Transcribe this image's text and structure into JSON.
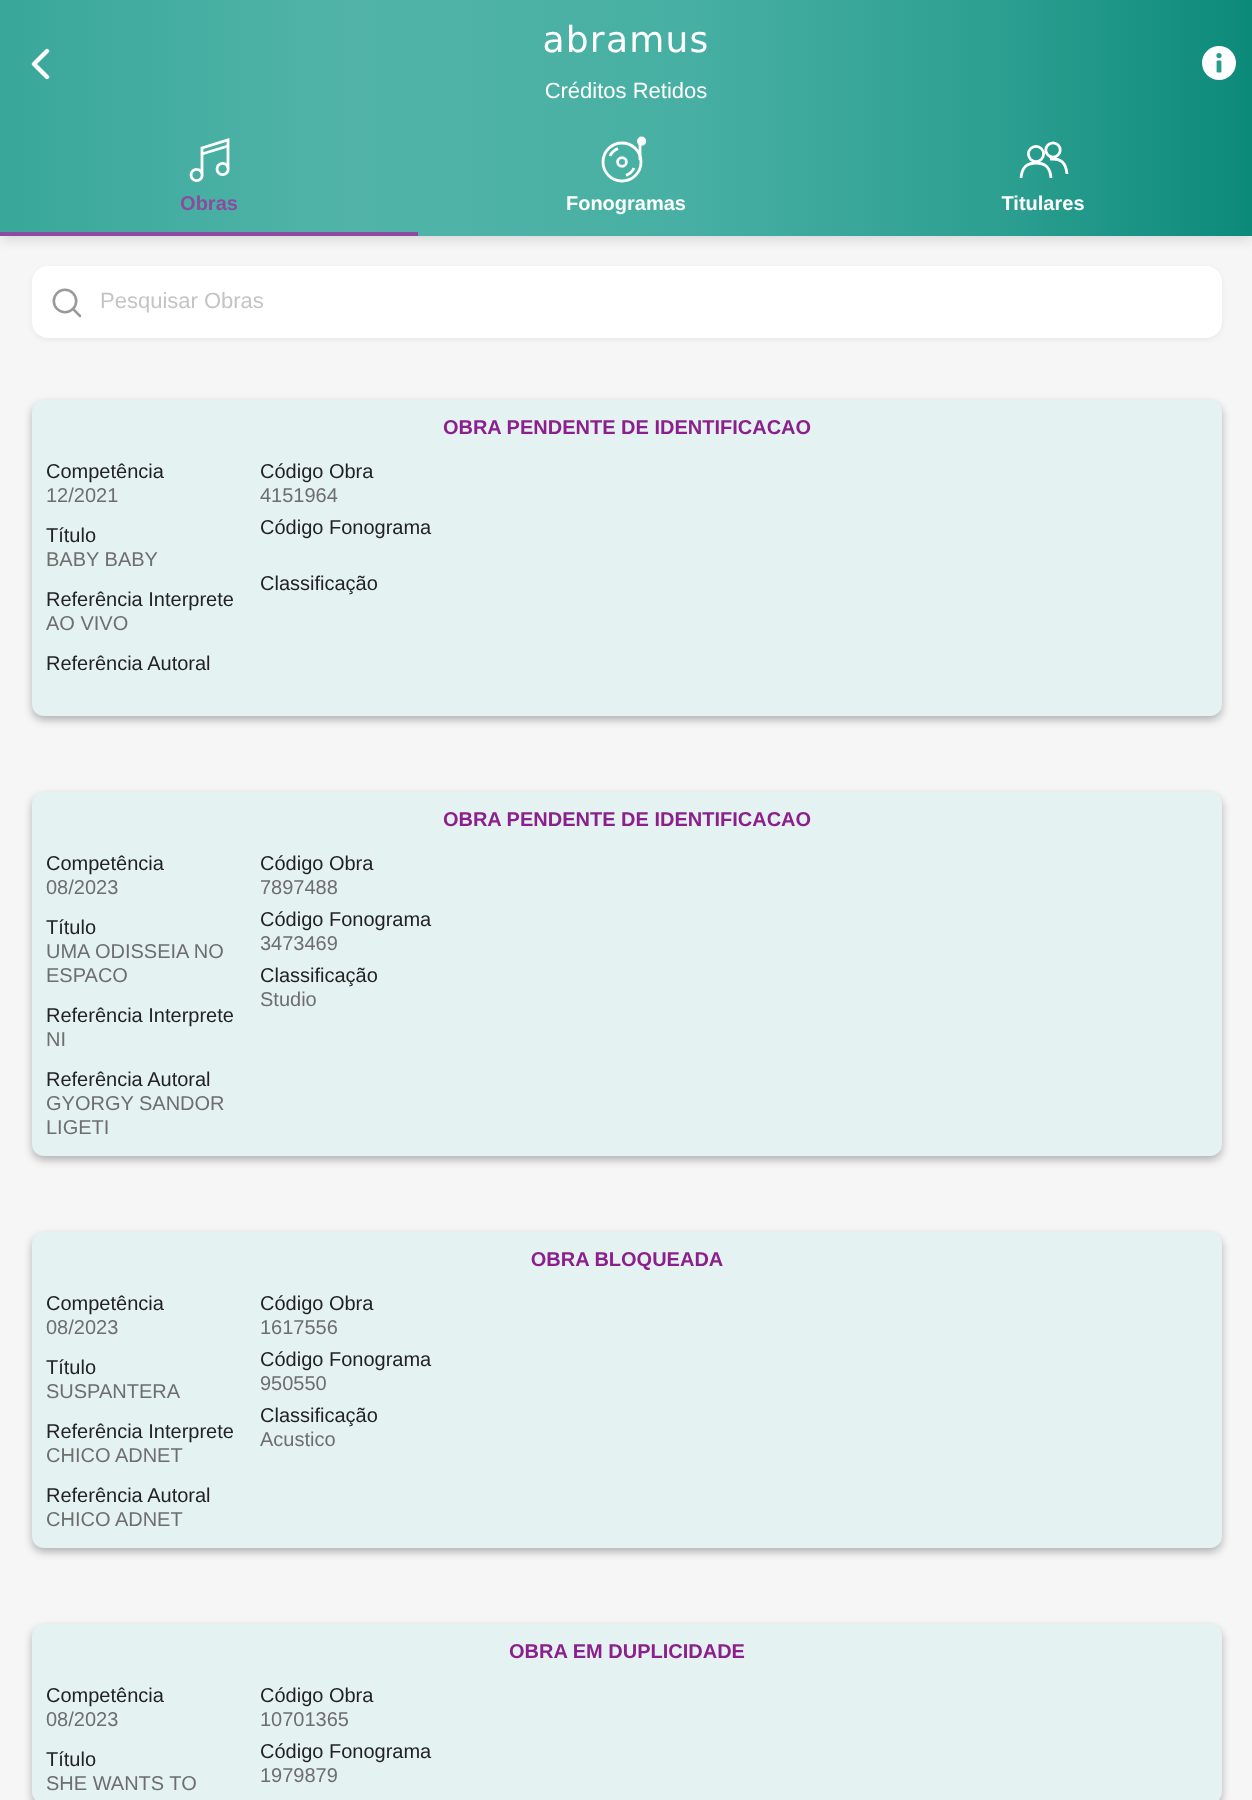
{
  "header": {
    "logo": "abramus",
    "title": "Créditos Retidos"
  },
  "tabs": [
    {
      "label": "Obras",
      "selected": true
    },
    {
      "label": "Fonogramas",
      "selected": false
    },
    {
      "label": "Titulares",
      "selected": false
    }
  ],
  "search": {
    "placeholder": "Pesquisar Obras"
  },
  "cards": [
    {
      "status": "OBRA PENDENTE DE IDENTIFICACAO",
      "left": [
        {
          "label": "Competência",
          "value": "12/2021"
        },
        {
          "label": "Título",
          "value": "BABY BABY"
        },
        {
          "label": "Referência Interprete",
          "value": "AO VIVO"
        },
        {
          "label": "Referência Autoral"
        }
      ],
      "right": [
        {
          "label": "Código Obra",
          "value": "4151964"
        },
        {
          "label": "Código Fonograma"
        },
        {
          "label": "Classificação"
        }
      ]
    },
    {
      "status": "OBRA PENDENTE DE IDENTIFICACAO",
      "left": [
        {
          "label": "Competência",
          "value": "08/2023"
        },
        {
          "label": "Título",
          "value": "UMA ODISSEIA NO ESPACO"
        },
        {
          "label": "Referência Interprete",
          "value": "NI"
        },
        {
          "label": "Referência Autoral",
          "value": "GYORGY SANDOR LIGETI"
        }
      ],
      "right": [
        {
          "label": "Código Obra",
          "value": "7897488"
        },
        {
          "label": "Código Fonograma",
          "value": "3473469"
        },
        {
          "label": "Classificação",
          "value": "Studio"
        }
      ]
    },
    {
      "status": "OBRA BLOQUEADA",
      "left": [
        {
          "label": "Competência",
          "value": "08/2023"
        },
        {
          "label": "Título",
          "value": "SUSPANTERA"
        },
        {
          "label": "Referência Interprete",
          "value": "CHICO ADNET"
        },
        {
          "label": "Referência Autoral",
          "value": "CHICO ADNET"
        }
      ],
      "right": [
        {
          "label": "Código Obra",
          "value": "1617556"
        },
        {
          "label": "Código Fonograma",
          "value": "950550"
        },
        {
          "label": "Classificação",
          "value": "Acustico"
        }
      ]
    },
    {
      "status": "OBRA EM DUPLICIDADE",
      "left": [
        {
          "label": "Competência",
          "value": "08/2023"
        },
        {
          "label": "Título",
          "value": "SHE WANTS TO"
        }
      ],
      "right": [
        {
          "label": "Código Obra",
          "value": "10701365"
        },
        {
          "label": "Código Fonograma",
          "value": "1979879"
        }
      ]
    }
  ]
}
